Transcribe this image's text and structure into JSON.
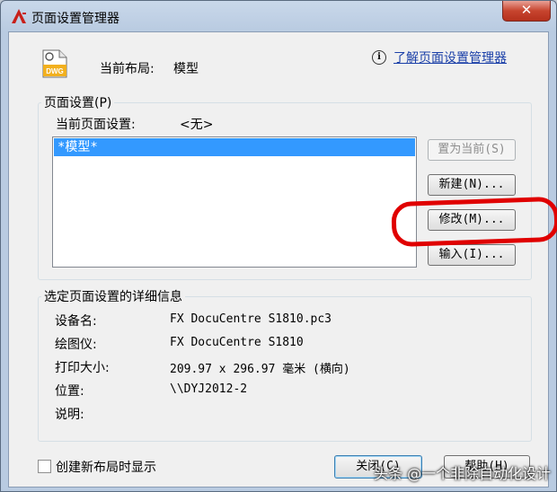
{
  "window": {
    "title": "页面设置管理器",
    "close_symbol": "✕"
  },
  "header": {
    "icon_text": "DWG",
    "layout_label": "当前布局:",
    "layout_value": "模型",
    "help_symbol": "i",
    "help_link": "了解页面设置管理器"
  },
  "page_setup": {
    "group_title": "页面设置(P)",
    "current_label": "当前页面设置:",
    "current_value": "<无>",
    "list_items": [
      "*模型*"
    ],
    "buttons": {
      "set_current": "置为当前(S)",
      "new": "新建(N)...",
      "modify": "修改(M)...",
      "import": "输入(I)..."
    }
  },
  "details": {
    "group_title": "选定页面设置的详细信息",
    "rows": [
      {
        "label": "设备名:",
        "value": "FX DocuCentre S1810.pc3"
      },
      {
        "label": "绘图仪:",
        "value": "FX DocuCentre S1810"
      },
      {
        "label": "打印大小:",
        "value": "209.97 x 296.97 毫米 (横向)"
      },
      {
        "label": "位置:",
        "value": "\\\\DYJ2012-2"
      },
      {
        "label": "说明:",
        "value": ""
      }
    ]
  },
  "footer": {
    "checkbox_label": "创建新布局时显示",
    "checkbox_checked": false,
    "close_button": "关闭(C)",
    "help_button": "帮助(H)"
  },
  "watermark": "头条 @一个非除自动化设计",
  "colors": {
    "selection": "#3399ff",
    "annotation": "#e00000",
    "link": "#1a3fa8"
  }
}
